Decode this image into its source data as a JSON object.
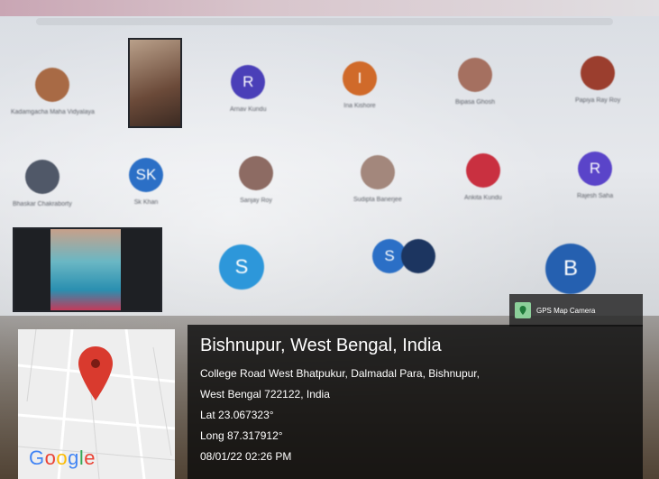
{
  "meeting": {
    "participants_row1": [
      {
        "initial": "",
        "name": "Kadamgacha Maha Vidyalaya",
        "color": "#a86a45"
      },
      {
        "initial": "R",
        "name": "Arnav Kundu",
        "color": "#4a3fb8"
      },
      {
        "initial": "I",
        "name": "Ina Kishore",
        "color": "#d06a2a"
      },
      {
        "initial": "",
        "name": "Bipasa Ghosh",
        "color": "#a57060"
      },
      {
        "initial": "",
        "name": "Papiya Ray Roy",
        "color": "#9b3e2e"
      }
    ],
    "participants_row2": [
      {
        "initial": "",
        "name": "Bhaskar Chakraborty",
        "color": "#505868"
      },
      {
        "initial": "SK",
        "name": "Sk Khan",
        "color": "#2b6fc6"
      },
      {
        "initial": "",
        "name": "Sanjay Roy",
        "color": "#8d6b63"
      },
      {
        "initial": "",
        "name": "Sudipta Banerjee",
        "color": "#a3877c"
      },
      {
        "initial": "",
        "name": "Ankita Kundu",
        "color": "#c93040"
      },
      {
        "initial": "R",
        "name": "Rajesh Saha",
        "color": "#5a44c9"
      }
    ],
    "participants_row3": [
      {
        "initial": "S",
        "name": "",
        "color": "#2d97da"
      },
      {
        "initial": "S",
        "name": "",
        "color": "#2b6fc6"
      },
      {
        "initial": "B",
        "name": "",
        "color": "#2560b0"
      }
    ]
  },
  "gps": {
    "badge_label": "GPS Map Camera",
    "place": "Bishnupur, West Bengal, India",
    "address_line1": "College Road West Bhatpukur, Dalmadal Para, Bishnupur,",
    "address_line2": "West Bengal 722122, India",
    "lat": "Lat 23.067323°",
    "long": "Long 87.317912°",
    "timestamp": "08/01/22 02:26 PM",
    "map_brand": "Google",
    "pin_color": "#d93a2e"
  }
}
